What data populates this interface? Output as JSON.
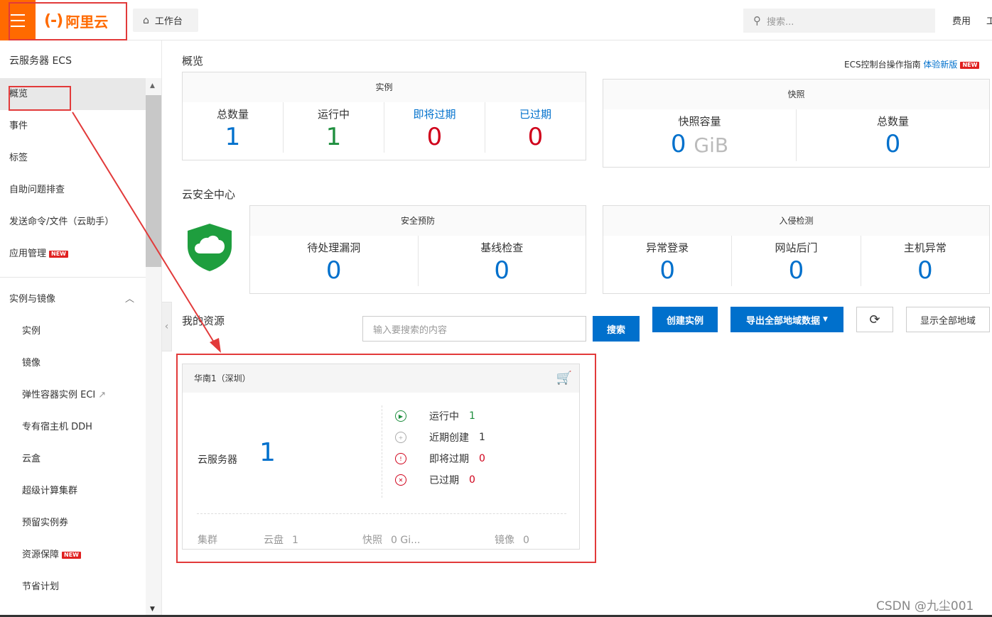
{
  "topbar": {
    "logo_text": "阿里云",
    "logo_mark": "(-)",
    "workbench_label": "工作台",
    "search_placeholder": "搜索...",
    "fee_label": "费用",
    "next_label": "工"
  },
  "sidebar": {
    "title": "云服务器 ECS",
    "items": [
      {
        "label": "概览",
        "active": true
      },
      {
        "label": "事件"
      },
      {
        "label": "标签"
      },
      {
        "label": "自助问题排查"
      },
      {
        "label": "发送命令/文件（云助手）"
      },
      {
        "label": "应用管理",
        "badge": "NEW"
      }
    ],
    "group": {
      "label": "实例与镜像",
      "items": [
        {
          "label": "实例"
        },
        {
          "label": "镜像"
        },
        {
          "label": "弹性容器实例 ECI",
          "external": true
        },
        {
          "label": "专有宿主机 DDH"
        },
        {
          "label": "云盒"
        },
        {
          "label": "超级计算集群"
        },
        {
          "label": "预留实例券"
        },
        {
          "label": "资源保障",
          "badge": "NEW"
        },
        {
          "label": "节省计划"
        }
      ]
    }
  },
  "overview": {
    "title": "概览",
    "guide_text": "ECS控制台操作指南",
    "guide_link": "体验新版",
    "guide_badge": "NEW",
    "instances": {
      "title": "实例",
      "stats": [
        {
          "label": "总数量",
          "value": "1",
          "color": "#0070cc"
        },
        {
          "label": "运行中",
          "value": "1",
          "color": "#1e8e3e"
        },
        {
          "label": "即将过期",
          "value": "0",
          "color": "#d0021b"
        },
        {
          "label": "已过期",
          "value": "0",
          "color": "#d0021b"
        }
      ]
    },
    "snapshots": {
      "title": "快照",
      "stats": [
        {
          "label": "快照容量",
          "value": "0",
          "unit": "GiB"
        },
        {
          "label": "总数量",
          "value": "0"
        }
      ]
    }
  },
  "security": {
    "title": "云安全中心",
    "prevention": {
      "title": "安全预防",
      "stats": [
        {
          "label": "待处理漏洞",
          "value": "0"
        },
        {
          "label": "基线检查",
          "value": "0"
        }
      ]
    },
    "intrusion": {
      "title": "入侵检测",
      "stats": [
        {
          "label": "异常登录",
          "value": "0"
        },
        {
          "label": "网站后门",
          "value": "0"
        },
        {
          "label": "主机异常",
          "value": "0"
        }
      ]
    }
  },
  "resources": {
    "title": "我的资源",
    "search_placeholder": "输入要搜索的内容",
    "search_button": "搜索",
    "create_button": "创建实例",
    "export_button": "导出全部地域数据",
    "show_all_button": "显示全部地域",
    "region": {
      "name": "华南1（深圳）",
      "server_label": "云服务器",
      "server_count": "1",
      "statuses": [
        {
          "label": "运行中",
          "value": "1",
          "color": "#1e8e3e"
        },
        {
          "label": "近期创建",
          "value": "1",
          "color": "#333333"
        },
        {
          "label": "即将过期",
          "value": "0",
          "color": "#d0021b"
        },
        {
          "label": "已过期",
          "value": "0",
          "color": "#d0021b"
        }
      ],
      "footer": [
        {
          "label": "集群",
          "value": ""
        },
        {
          "label": "云盘",
          "value": "1"
        },
        {
          "label": "快照",
          "value": "0 Gi..."
        },
        {
          "label": "镜像",
          "value": "0"
        }
      ]
    }
  },
  "watermark": "CSDN @九尘001"
}
